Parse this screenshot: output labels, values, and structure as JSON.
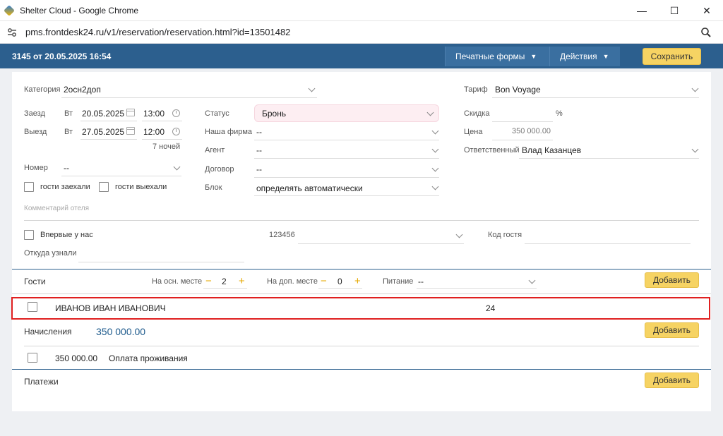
{
  "browser": {
    "window_title": "Shelter Cloud - Google Chrome",
    "url": "pms.frontdesk24.ru/v1/reservation/reservation.html?id=13501482",
    "controls": {
      "minimize": "—",
      "maximize": "☐",
      "close": "✕"
    }
  },
  "header": {
    "reservation_title": "3145 от 20.05.2025 16:54",
    "print_forms_label": "Печатные формы",
    "actions_label": "Действия",
    "save_label": "Сохранить",
    "bg_color": "#2c5f8e",
    "accent_color": "#f6d363"
  },
  "form": {
    "category": {
      "label": "Категория",
      "value": "2осн2доп"
    },
    "checkin": {
      "label": "Заезд",
      "weekday": "Вт",
      "date": "20.05.2025",
      "time": "13:00"
    },
    "checkout": {
      "label": "Выезд",
      "weekday": "Вт",
      "date": "27.05.2025",
      "time": "12:00"
    },
    "nights": "7 ночей",
    "room": {
      "label": "Номер",
      "value": "--"
    },
    "guests_checked_in": "гости заехали",
    "guests_checked_out": "гости выехали",
    "hotel_comment_placeholder": "Комментарий отеля",
    "status": {
      "label": "Статус",
      "value": "Бронь"
    },
    "our_firm": {
      "label": "Наша фирма",
      "value": "--"
    },
    "agent": {
      "label": "Агент",
      "value": "--"
    },
    "contract": {
      "label": "Договор",
      "value": "--"
    },
    "block": {
      "label": "Блок",
      "value": "определять автоматически"
    },
    "tariff": {
      "label": "Тариф",
      "value": "Bon Voyage"
    },
    "discount": {
      "label": "Скидка",
      "value": "",
      "unit": "%"
    },
    "price": {
      "label": "Цена",
      "value": "350 000.00"
    },
    "responsible": {
      "label": "Ответственный",
      "value": "Влад Казанцев"
    }
  },
  "guest_info": {
    "first_time_label": "Впервые у нас",
    "source_label": "Откуда узнали",
    "source_value": "",
    "code_value": "123456",
    "guest_code_label": "Код гостя",
    "guest_code_value": ""
  },
  "guests": {
    "section_label": "Гости",
    "main_place_label": "На осн. месте",
    "main_place_value": "2",
    "extra_place_label": "На доп. месте",
    "extra_place_value": "0",
    "meal_label": "Питание",
    "meal_value": "--",
    "add_label": "Добавить",
    "rows": [
      {
        "name": "ИВАНОВ ИВАН ИВАНОВИЧ",
        "age": "24"
      }
    ]
  },
  "charges": {
    "section_label": "Начисления",
    "total": "350 000.00",
    "add_label": "Добавить",
    "rows": [
      {
        "amount": "350 000.00",
        "description": "Оплата проживания"
      }
    ]
  },
  "payments": {
    "section_label": "Платежи",
    "add_label": "Добавить"
  }
}
